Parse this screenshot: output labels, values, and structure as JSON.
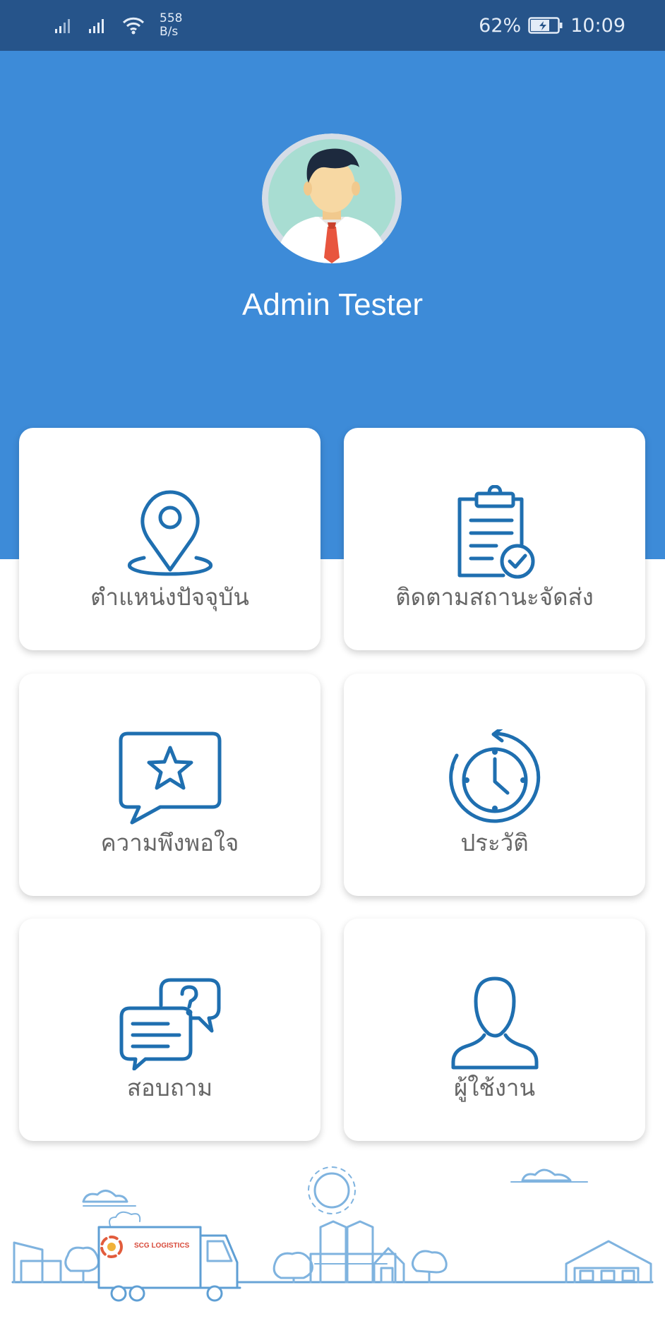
{
  "status_bar": {
    "network_speed_value": "558",
    "network_speed_unit": "B/s",
    "battery_percent": "62%",
    "time": "10:09",
    "icons": [
      "signal-icon",
      "signal-icon",
      "wifi-icon",
      "battery-icon"
    ]
  },
  "profile": {
    "name": "Admin Tester",
    "avatar_icon": "avatar-icon"
  },
  "menu": {
    "items": [
      {
        "label": "ตำแหน่งปัจจุบัน",
        "icon": "location-pin-icon"
      },
      {
        "label": "ติดตามสถานะจัดส่ง",
        "icon": "clipboard-check-icon"
      },
      {
        "label": "ความพึงพอใจ",
        "icon": "star-chat-icon"
      },
      {
        "label": "ประวัติ",
        "icon": "history-clock-icon"
      },
      {
        "label": "สอบถาม",
        "icon": "chat-question-icon"
      },
      {
        "label": "ผู้ใช้งาน",
        "icon": "user-icon"
      }
    ]
  },
  "footer": {
    "illustration_icon": "city-delivery-illustration",
    "truck_logo_text": "SCG LOGISTICS"
  },
  "colors": {
    "status_bar": "#26548a",
    "hero": "#3d8bd8",
    "icon_stroke": "#1f6fb0",
    "card_label": "#666666",
    "illustration": "#7fb3df"
  }
}
